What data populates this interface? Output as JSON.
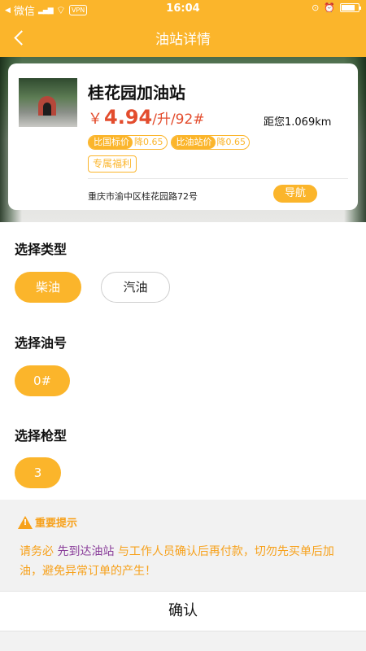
{
  "status_bar": {
    "carrier": "微信",
    "vpn": "VPN",
    "time": "16:04"
  },
  "nav": {
    "title": "油站详情"
  },
  "station": {
    "name": "桂花园加油站",
    "price_symbol": "￥",
    "price": "4.94",
    "price_unit": "/升/92#",
    "distance": "距您1.069km",
    "tags": [
      {
        "label": "比国标价",
        "value": "降0.65"
      },
      {
        "label": "比油站价",
        "value": "降0.65"
      }
    ],
    "welfare": "专属福利",
    "address": "重庆市渝中区桂花园路72号",
    "navigate_label": "导航"
  },
  "sections": {
    "type_title": "选择类型",
    "types": [
      "柴油",
      "汽油"
    ],
    "type_selected": "柴油",
    "grade_title": "选择油号",
    "grades": [
      "0#"
    ],
    "gun_title": "选择枪型",
    "guns": [
      "3"
    ]
  },
  "tip": {
    "title": "重要提示",
    "prefix": "请务必 ",
    "highlight": "先到达油站",
    "suffix": " 与工作人员确认后再付款，切勿先买单后加油，避免异常订单的产生！"
  },
  "confirm_label": "确认",
  "colors": {
    "accent": "#fbb52b",
    "price": "#e34c2d",
    "tip_text": "#f7a11b",
    "tip_highlight": "#8a3e9a"
  }
}
